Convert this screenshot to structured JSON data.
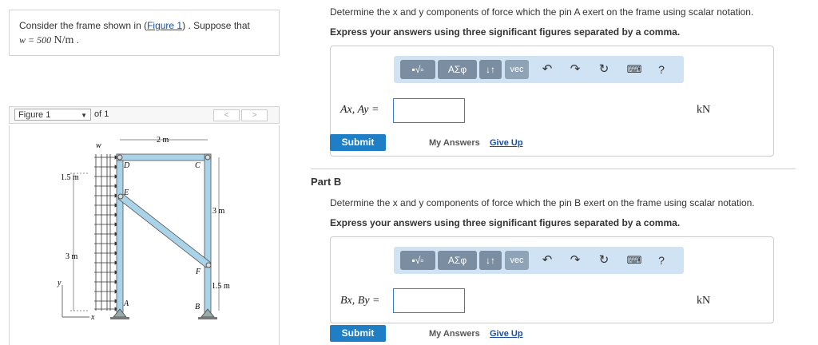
{
  "problem": {
    "intro": "Consider the frame shown in (",
    "figure_link": "Figure 1",
    "intro_end": ") . Suppose that",
    "w_label": "w = 500",
    "w_unit": "N/m"
  },
  "figure_nav": {
    "selected": "Figure 1",
    "of_text": "of 1",
    "prev": "<",
    "next": ">"
  },
  "figure": {
    "labels": {
      "w": "w",
      "D": "D",
      "C": "C",
      "E": "E",
      "F": "F",
      "A": "A",
      "B": "B",
      "x": "x",
      "y": "y",
      "dim_top": "2 m",
      "dim_15": "1.5 m",
      "dim_3left": "3 m",
      "dim_3right": "3 m",
      "dim_15right": "1.5 m"
    }
  },
  "partA": {
    "question": "Determine the x and y components of force which the pin A exert on the frame using scalar notation.",
    "instruction": "Express your answers using three significant figures separated by a comma.",
    "label": "Ax, Ay =",
    "unit": "kN",
    "submit": "Submit",
    "my_answers": "My Answers",
    "give_up": "Give Up"
  },
  "partB": {
    "title": "Part B",
    "question": "Determine the x and y components of force which the pin B exert on the frame using scalar notation.",
    "instruction": "Express your answers using three significant figures separated by a comma.",
    "label": "Bx, By =",
    "unit": "kN",
    "submit": "Submit",
    "my_answers": "My Answers",
    "give_up": "Give Up"
  },
  "toolbar": {
    "greek": "ΑΣφ",
    "arrows": "↓↑",
    "vec": "vec",
    "help": "?"
  }
}
